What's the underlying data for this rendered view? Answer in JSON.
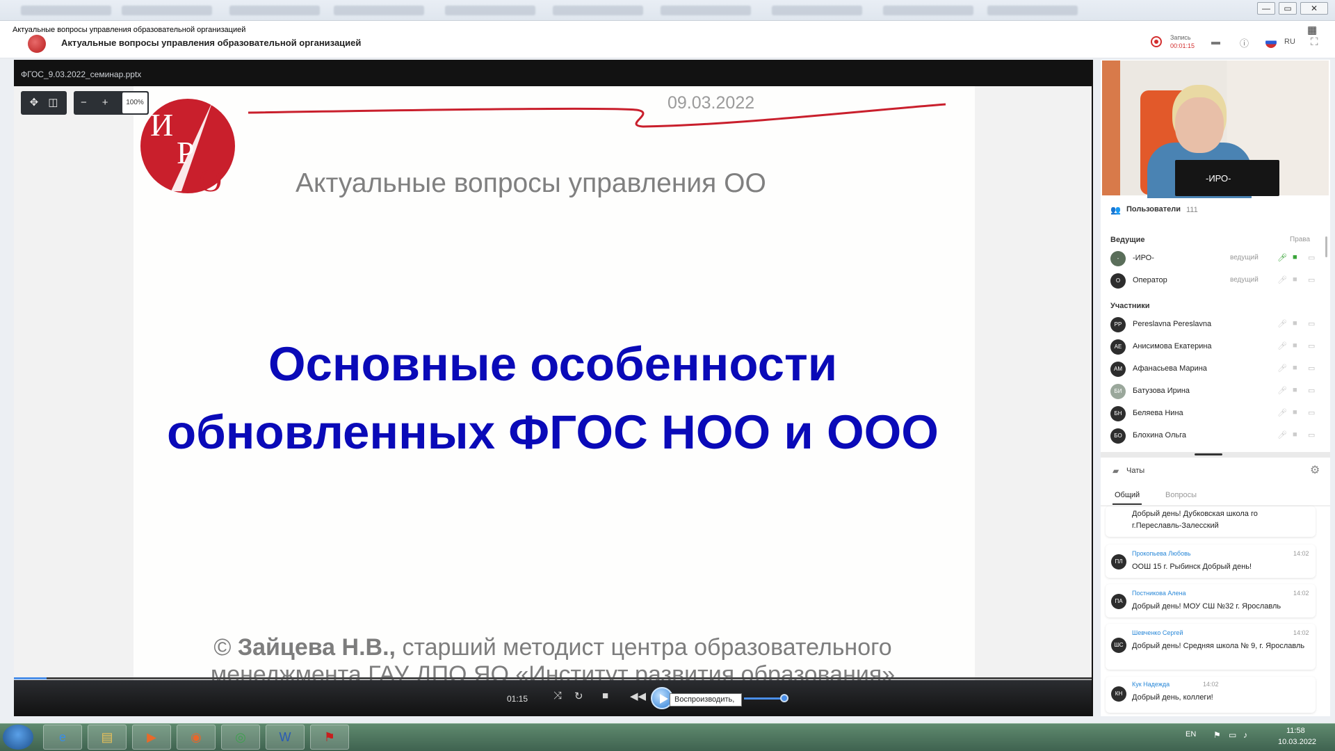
{
  "window": {
    "tooltip_title": "Актуальные вопросы управления образовательной организацией",
    "controls": {
      "minimize": "—",
      "maximize": "▭",
      "close": "✕"
    }
  },
  "header": {
    "conference_title": "Актуальные вопросы управления образовательной организацией",
    "record_label": "Запись",
    "record_time": "00:01:15",
    "language": "RU"
  },
  "presentation": {
    "file_name": "ФГОС_9.03.2022_семинар.pptx",
    "zoom": "100%",
    "toolbar": {
      "move": "✥",
      "fit": "◫",
      "zoom_out": "−",
      "zoom_in": "+"
    },
    "slide": {
      "logo_text": "ИРО",
      "date": "09.03.2022",
      "subtitle": "Актуальные вопросы управления ОО",
      "main_line1": "Основные особенности",
      "main_line2": "обновленных ФГОС НОО и ООО",
      "author_prefix": "© ",
      "author_name": "Зайцева Н.В.,",
      "author_rest": " старший методист центра образовательного",
      "author_line2": "менеджмента ГАУ ДПО ЯО «Институт развития образования»"
    },
    "player": {
      "current_time": "01:15",
      "progress_fraction": 0.03,
      "play_tooltip": "Воспроизводить,",
      "volume_fraction": 0.9
    }
  },
  "video": {
    "label": "-ИРО-"
  },
  "users": {
    "header": "Пользователи",
    "count": "111",
    "hosts_label": "Ведущие",
    "rights_label": "Права",
    "hosts": [
      {
        "initials": "-",
        "name": "-ИРО-",
        "role": "ведущий"
      },
      {
        "initials": "О",
        "name": "Оператор",
        "role": "ведущий"
      }
    ],
    "participants_label": "Участники",
    "participants": [
      {
        "initials": "PP",
        "name": "Pereslavna Pereslavna"
      },
      {
        "initials": "АЕ",
        "name": "Анисимова Екатерина"
      },
      {
        "initials": "АМ",
        "name": "Афанасьева Марина"
      },
      {
        "initials": "БИ",
        "name": "Батузова Ирина"
      },
      {
        "initials": "БН",
        "name": "Беляева Нина"
      },
      {
        "initials": "БО",
        "name": "Блохина Ольга"
      }
    ]
  },
  "chats": {
    "header": "Чаты",
    "tabs": [
      "Общий",
      "Вопросы"
    ],
    "messages": [
      {
        "initials": "",
        "name": "",
        "time": "",
        "text": "Добрый день! Дубковская школа го г.Переславль-Залесский"
      },
      {
        "initials": "ПЛ",
        "name": "Прокопьева Любовь",
        "time": "14:02",
        "text": "ООШ 15 г. Рыбинск Добрый день!"
      },
      {
        "initials": "ПА",
        "name": "Постникова Алена",
        "time": "14:02",
        "text": "Добрый день! МОУ СШ №32 г. Ярославль"
      },
      {
        "initials": "ШС",
        "name": "Шевченко Сергей",
        "time": "14:02",
        "text": "Добрый день! Средняя школа № 9, г. Ярославль"
      },
      {
        "initials": "КН",
        "name": "Кук Надежда",
        "time": "14:02",
        "text": "Добрый день, коллеги!"
      }
    ]
  },
  "taskbar": {
    "apps": [
      "IE",
      "Folder",
      "Media",
      "Firefox",
      "Chrome",
      "Word",
      "PDF"
    ],
    "lang": "EN",
    "time": "11:58",
    "date": "10.03.2022"
  },
  "colors": {
    "slide_title": "#0a0ab8",
    "accent": "#4a8ee8",
    "record": "#d32f2f"
  }
}
